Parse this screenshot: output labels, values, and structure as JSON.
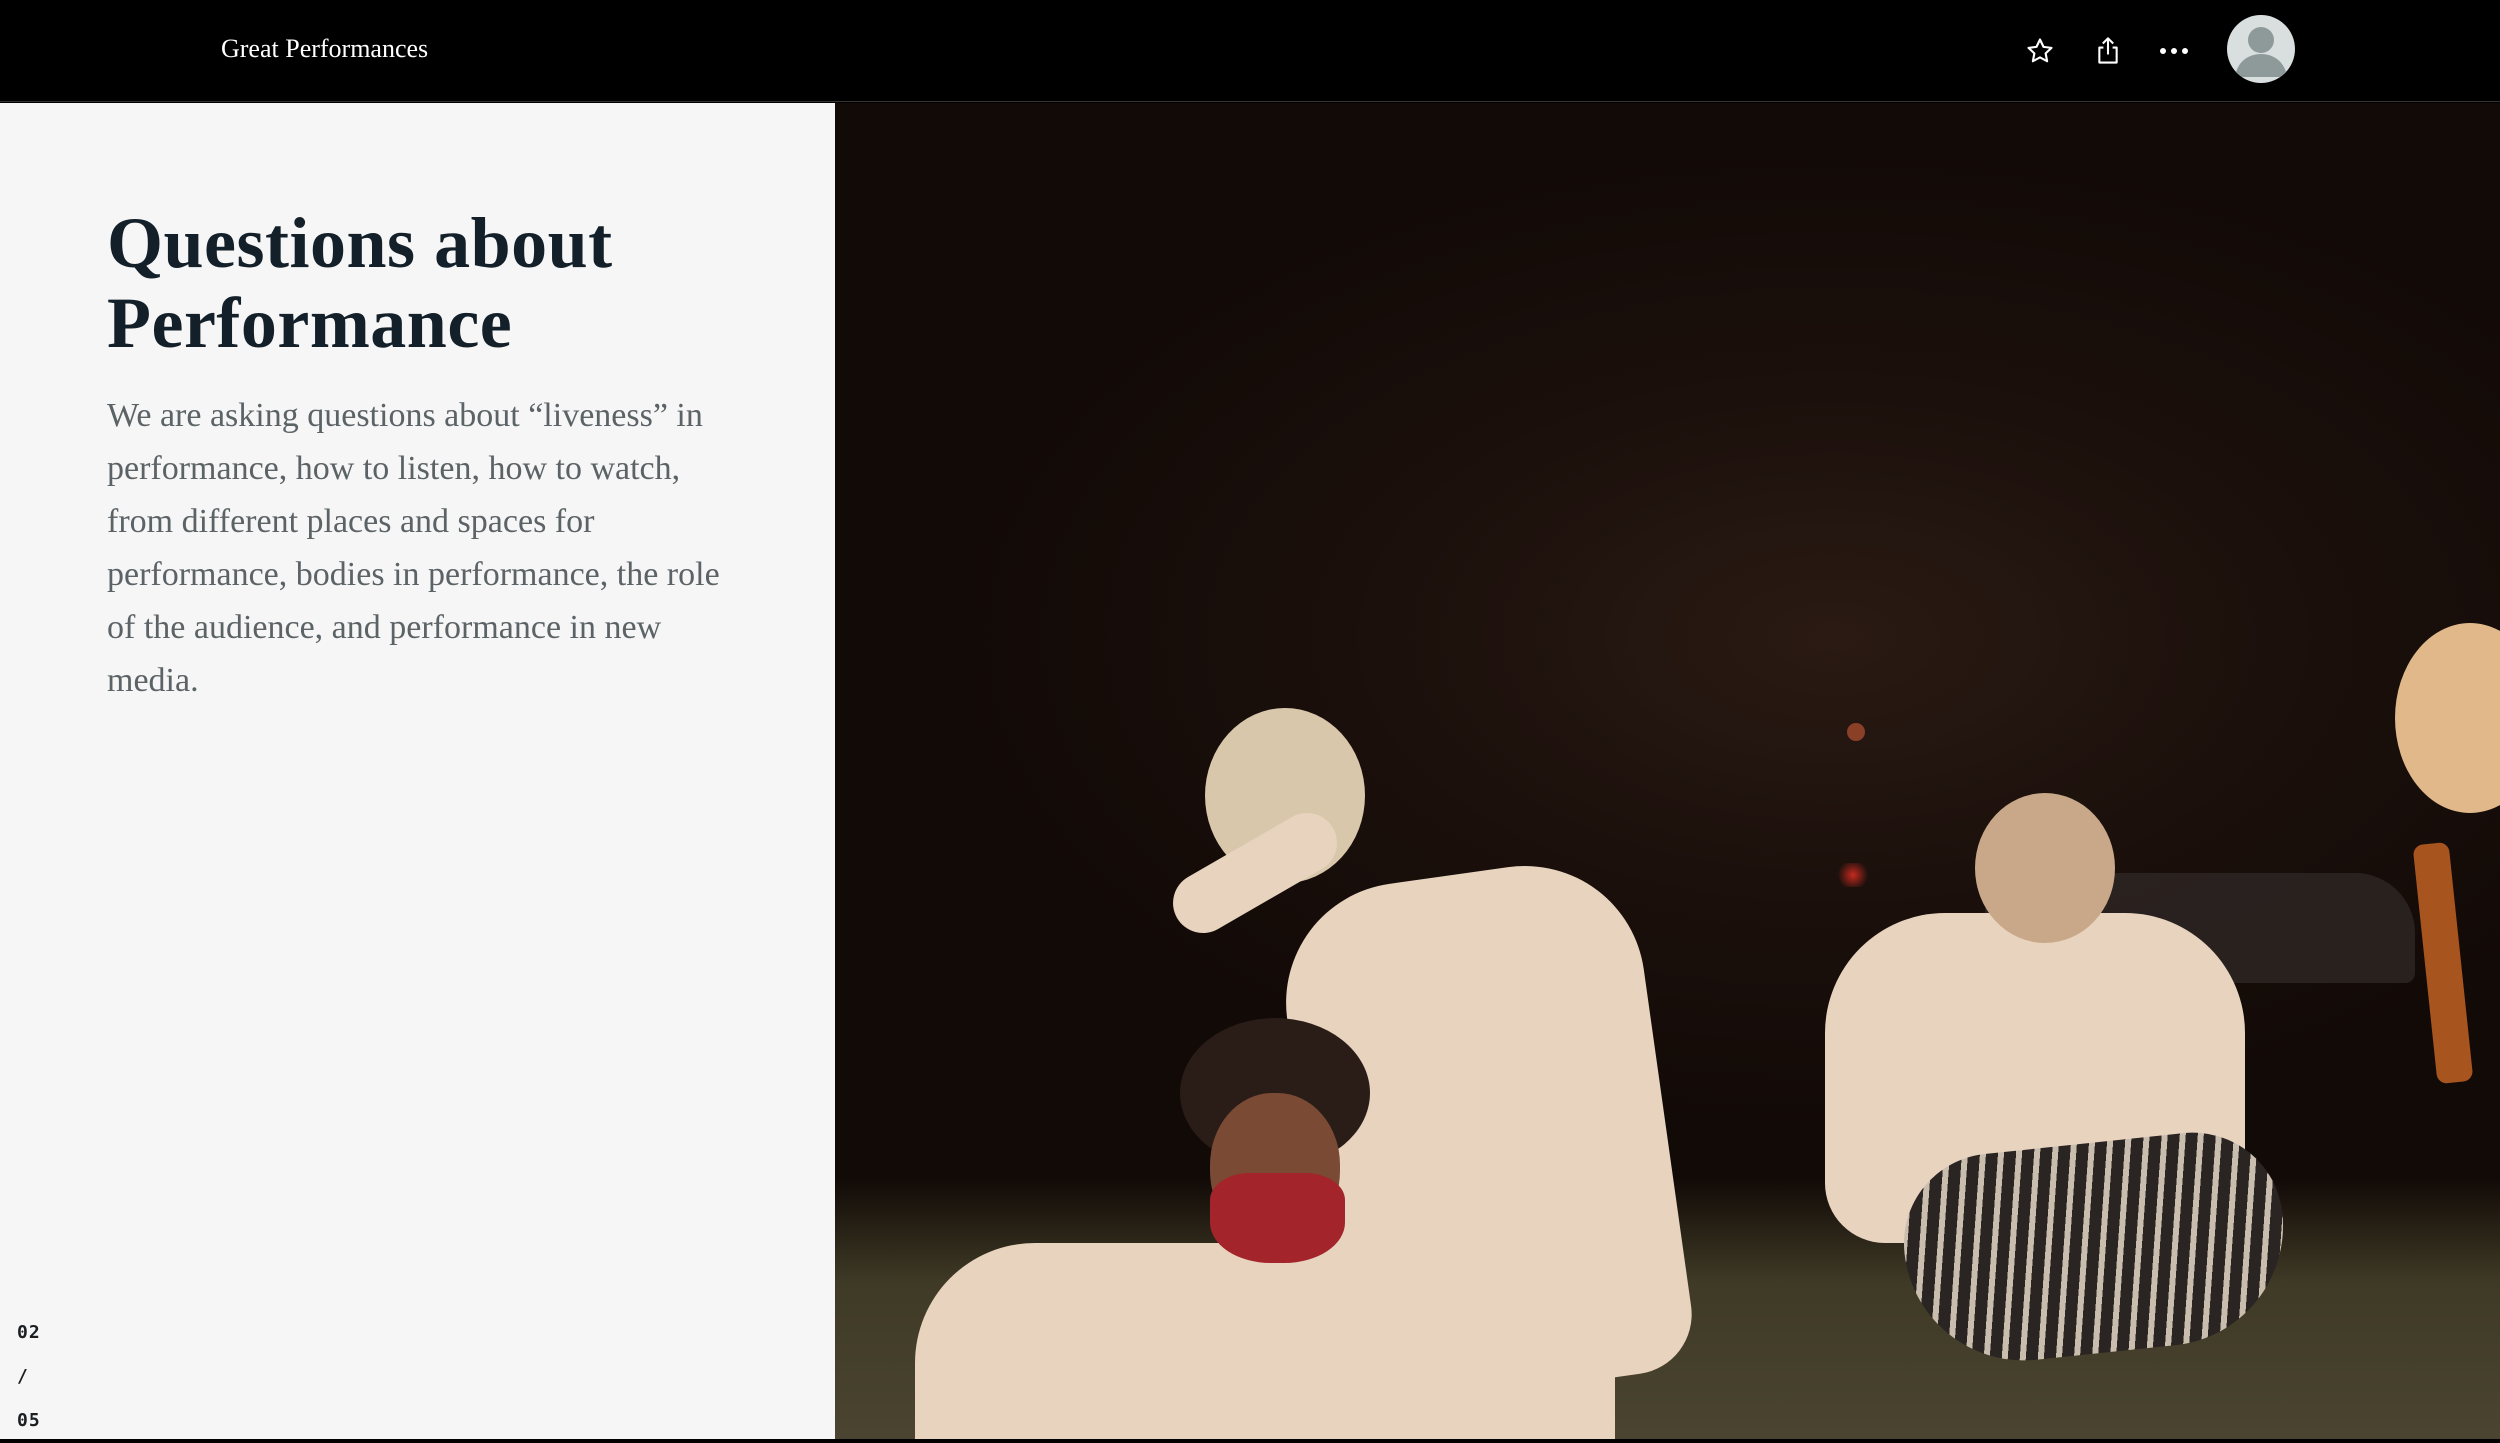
{
  "header": {
    "brand": "Great Performances",
    "icons": {
      "favorite": "star-icon",
      "share": "share-icon",
      "more": "more-icon",
      "profile": "avatar-icon"
    }
  },
  "main": {
    "title": "Questions about Performance",
    "body": "We are asking questions about “liveness” in performance, how to listen, how to watch, from different places and spaces for performance, bodies in performance, the role of the audience, and performance in new media."
  },
  "pager": {
    "current": "02",
    "separator": "/",
    "total": "05"
  },
  "colors": {
    "topbar": "#000000",
    "panel": "#f6f6f6",
    "title": "#13202a",
    "body": "#5c6366"
  }
}
